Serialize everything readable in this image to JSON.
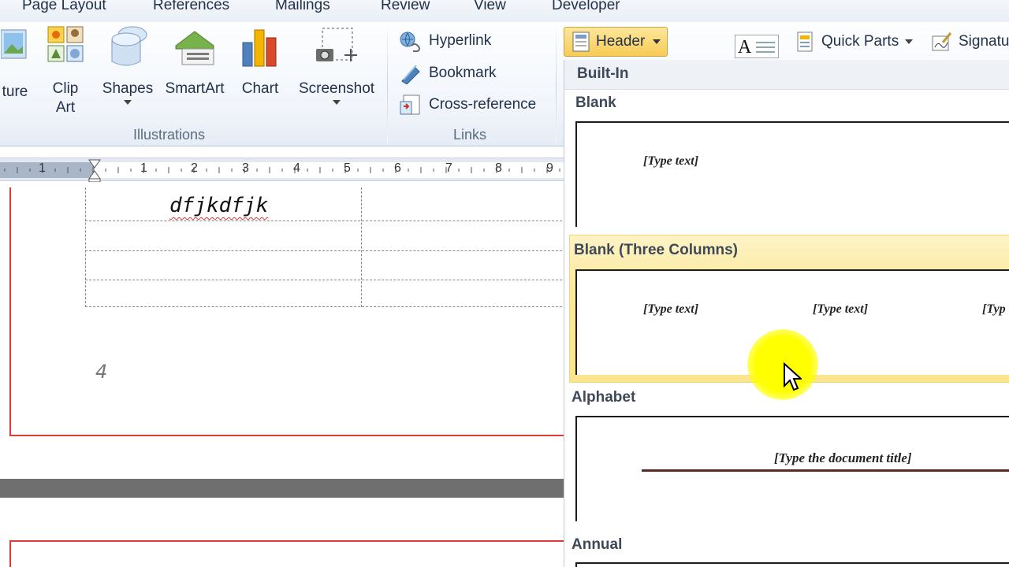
{
  "tabs": [
    {
      "label": "Page Layout"
    },
    {
      "label": "References"
    },
    {
      "label": "Mailings"
    },
    {
      "label": "Review"
    },
    {
      "label": "View"
    },
    {
      "label": "Developer"
    }
  ],
  "ribbon": {
    "illustrations": {
      "group_label": "Illustrations",
      "picture_label": "ture",
      "clipart_label_1": "Clip",
      "clipart_label_2": "Art",
      "shapes_label": "Shapes",
      "smartart_label": "SmartArt",
      "chart_label": "Chart",
      "screenshot_label": "Screenshot"
    },
    "links": {
      "group_label": "Links",
      "hyperlink_label": "Hyperlink",
      "bookmark_label": "Bookmark",
      "crossref_label": "Cross-reference"
    },
    "header_footer": {
      "header_label": "Header"
    },
    "text": {
      "textbox_glyph": "A",
      "quickparts_label": "Quick Parts",
      "signature_label": "Signatu"
    }
  },
  "ruler": {
    "left_labels": [
      "1"
    ],
    "right_labels": [
      "1",
      "2",
      "3",
      "4",
      "5",
      "6",
      "7",
      "8",
      "9"
    ]
  },
  "document": {
    "text": "dfjkdfjk",
    "page_number": "4"
  },
  "gallery": {
    "section": "Built-In",
    "items": [
      {
        "title": "Blank",
        "placeholders": [
          "[Type text]"
        ]
      },
      {
        "title": "Blank (Three Columns)",
        "placeholders": [
          "[Type text]",
          "[Type text]",
          "[Typ"
        ]
      },
      {
        "title": "Alphabet",
        "placeholders": [
          "[Type the document title]"
        ]
      },
      {
        "title": "Annual",
        "placeholders": []
      }
    ]
  },
  "colors": {
    "accent_header_button": "#f8cb56",
    "gallery_highlight": "#fce89a",
    "page_border": "#e03b3b",
    "cursor_highlight": "#ffff00"
  }
}
